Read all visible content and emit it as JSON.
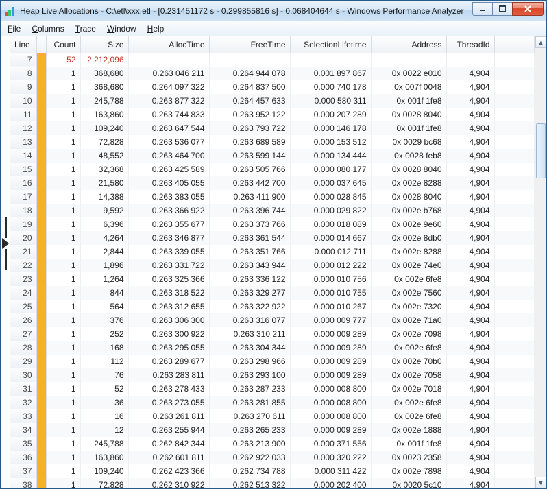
{
  "window": {
    "title": "Heap Live Allocations - C:\\etl\\xxx.etl - [0.231451172 s - 0.299855816 s] - 0.068404644 s - Windows Performance Analyzer"
  },
  "menubar": {
    "items": [
      {
        "label": "File",
        "ul": "F"
      },
      {
        "label": "Columns",
        "ul": "C"
      },
      {
        "label": "Trace",
        "ul": "T"
      },
      {
        "label": "Window",
        "ul": "W"
      },
      {
        "label": "Help",
        "ul": "H"
      }
    ]
  },
  "columns": {
    "line": "Line",
    "count": "Count",
    "size": "Size",
    "alloc": "AllocTime",
    "free": "FreeTime",
    "sel": "SelectionLifetime",
    "addr": "Address",
    "thread": "ThreadId"
  },
  "indicator": {
    "top_row_index": 13,
    "span_rows": 5
  },
  "rows": [
    {
      "line": 7,
      "count": 52,
      "size": "2,212,096",
      "alloc": "",
      "free": "",
      "sel": "",
      "addr": "",
      "thread": "",
      "highlight": true
    },
    {
      "line": 8,
      "count": 1,
      "size": "368,680",
      "alloc": "0.263 046 211",
      "free": "0.264 944 078",
      "sel": "0.001 897 867",
      "addr": "0x 0022 e010",
      "thread": "4,904"
    },
    {
      "line": 9,
      "count": 1,
      "size": "368,680",
      "alloc": "0.264 097 322",
      "free": "0.264 837 500",
      "sel": "0.000 740 178",
      "addr": "0x 007f 0048",
      "thread": "4,904"
    },
    {
      "line": 10,
      "count": 1,
      "size": "245,788",
      "alloc": "0.263 877 322",
      "free": "0.264 457 633",
      "sel": "0.000 580 311",
      "addr": "0x 001f 1fe8",
      "thread": "4,904"
    },
    {
      "line": 11,
      "count": 1,
      "size": "163,860",
      "alloc": "0.263 744 833",
      "free": "0.263 952 122",
      "sel": "0.000 207 289",
      "addr": "0x 0028 8040",
      "thread": "4,904"
    },
    {
      "line": 12,
      "count": 1,
      "size": "109,240",
      "alloc": "0.263 647 544",
      "free": "0.263 793 722",
      "sel": "0.000 146 178",
      "addr": "0x 001f 1fe8",
      "thread": "4,904"
    },
    {
      "line": 13,
      "count": 1,
      "size": "72,828",
      "alloc": "0.263 536 077",
      "free": "0.263 689 589",
      "sel": "0.000 153 512",
      "addr": "0x 0029 bc68",
      "thread": "4,904"
    },
    {
      "line": 14,
      "count": 1,
      "size": "48,552",
      "alloc": "0.263 464 700",
      "free": "0.263 599 144",
      "sel": "0.000 134 444",
      "addr": "0x 0028 feb8",
      "thread": "4,904"
    },
    {
      "line": 15,
      "count": 1,
      "size": "32,368",
      "alloc": "0.263 425 589",
      "free": "0.263 505 766",
      "sel": "0.000 080 177",
      "addr": "0x 0028 8040",
      "thread": "4,904"
    },
    {
      "line": 16,
      "count": 1,
      "size": "21,580",
      "alloc": "0.263 405 055",
      "free": "0.263 442 700",
      "sel": "0.000 037 645",
      "addr": "0x 002e 8288",
      "thread": "4,904"
    },
    {
      "line": 17,
      "count": 1,
      "size": "14,388",
      "alloc": "0.263 383 055",
      "free": "0.263 411 900",
      "sel": "0.000 028 845",
      "addr": "0x 0028 8040",
      "thread": "4,904"
    },
    {
      "line": 18,
      "count": 1,
      "size": "9,592",
      "alloc": "0.263 366 922",
      "free": "0.263 396 744",
      "sel": "0.000 029 822",
      "addr": "0x 002e b768",
      "thread": "4,904"
    },
    {
      "line": 19,
      "count": 1,
      "size": "6,396",
      "alloc": "0.263 355 677",
      "free": "0.263 373 766",
      "sel": "0.000 018 089",
      "addr": "0x 002e 9e60",
      "thread": "4,904"
    },
    {
      "line": 20,
      "count": 1,
      "size": "4,264",
      "alloc": "0.263 346 877",
      "free": "0.263 361 544",
      "sel": "0.000 014 667",
      "addr": "0x 002e 8db0",
      "thread": "4,904"
    },
    {
      "line": 21,
      "count": 1,
      "size": "2,844",
      "alloc": "0.263 339 055",
      "free": "0.263 351 766",
      "sel": "0.000 012 711",
      "addr": "0x 002e 8288",
      "thread": "4,904"
    },
    {
      "line": 22,
      "count": 1,
      "size": "1,896",
      "alloc": "0.263 331 722",
      "free": "0.263 343 944",
      "sel": "0.000 012 222",
      "addr": "0x 002e 74e0",
      "thread": "4,904"
    },
    {
      "line": 23,
      "count": 1,
      "size": "1,264",
      "alloc": "0.263 325 366",
      "free": "0.263 336 122",
      "sel": "0.000 010 756",
      "addr": "0x 002e 6fe8",
      "thread": "4,904"
    },
    {
      "line": 24,
      "count": 1,
      "size": "844",
      "alloc": "0.263 318 522",
      "free": "0.263 329 277",
      "sel": "0.000 010 755",
      "addr": "0x 002e 7560",
      "thread": "4,904"
    },
    {
      "line": 25,
      "count": 1,
      "size": "564",
      "alloc": "0.263 312 655",
      "free": "0.263 322 922",
      "sel": "0.000 010 267",
      "addr": "0x 002e 7320",
      "thread": "4,904"
    },
    {
      "line": 26,
      "count": 1,
      "size": "376",
      "alloc": "0.263 306 300",
      "free": "0.263 316 077",
      "sel": "0.000 009 777",
      "addr": "0x 002e 71a0",
      "thread": "4,904"
    },
    {
      "line": 27,
      "count": 1,
      "size": "252",
      "alloc": "0.263 300 922",
      "free": "0.263 310 211",
      "sel": "0.000 009 289",
      "addr": "0x 002e 7098",
      "thread": "4,904"
    },
    {
      "line": 28,
      "count": 1,
      "size": "168",
      "alloc": "0.263 295 055",
      "free": "0.263 304 344",
      "sel": "0.000 009 289",
      "addr": "0x 002e 6fe8",
      "thread": "4,904"
    },
    {
      "line": 29,
      "count": 1,
      "size": "112",
      "alloc": "0.263 289 677",
      "free": "0.263 298 966",
      "sel": "0.000 009 289",
      "addr": "0x 002e 70b0",
      "thread": "4,904"
    },
    {
      "line": 30,
      "count": 1,
      "size": "76",
      "alloc": "0.263 283 811",
      "free": "0.263 293 100",
      "sel": "0.000 009 289",
      "addr": "0x 002e 7058",
      "thread": "4,904"
    },
    {
      "line": 31,
      "count": 1,
      "size": "52",
      "alloc": "0.263 278 433",
      "free": "0.263 287 233",
      "sel": "0.000 008 800",
      "addr": "0x 002e 7018",
      "thread": "4,904"
    },
    {
      "line": 32,
      "count": 1,
      "size": "36",
      "alloc": "0.263 273 055",
      "free": "0.263 281 855",
      "sel": "0.000 008 800",
      "addr": "0x 002e 6fe8",
      "thread": "4,904"
    },
    {
      "line": 33,
      "count": 1,
      "size": "16",
      "alloc": "0.263 261 811",
      "free": "0.263 270 611",
      "sel": "0.000 008 800",
      "addr": "0x 002e 6fe8",
      "thread": "4,904"
    },
    {
      "line": 34,
      "count": 1,
      "size": "12",
      "alloc": "0.263 255 944",
      "free": "0.263 265 233",
      "sel": "0.000 009 289",
      "addr": "0x 002e 1888",
      "thread": "4,904"
    },
    {
      "line": 35,
      "count": 1,
      "size": "245,788",
      "alloc": "0.262 842 344",
      "free": "0.263 213 900",
      "sel": "0.000 371 556",
      "addr": "0x 001f 1fe8",
      "thread": "4,904"
    },
    {
      "line": 36,
      "count": 1,
      "size": "163,860",
      "alloc": "0.262 601 811",
      "free": "0.262 922 033",
      "sel": "0.000 320 222",
      "addr": "0x 0023 2358",
      "thread": "4,904"
    },
    {
      "line": 37,
      "count": 1,
      "size": "109,240",
      "alloc": "0.262 423 366",
      "free": "0.262 734 788",
      "sel": "0.000 311 422",
      "addr": "0x 002e 7898",
      "thread": "4,904"
    },
    {
      "line": 38,
      "count": 1,
      "size": "72,828",
      "alloc": "0.262 310 922",
      "free": "0.262 513 322",
      "sel": "0.000 202 400",
      "addr": "0x 0020 5c10",
      "thread": "4,904"
    }
  ]
}
